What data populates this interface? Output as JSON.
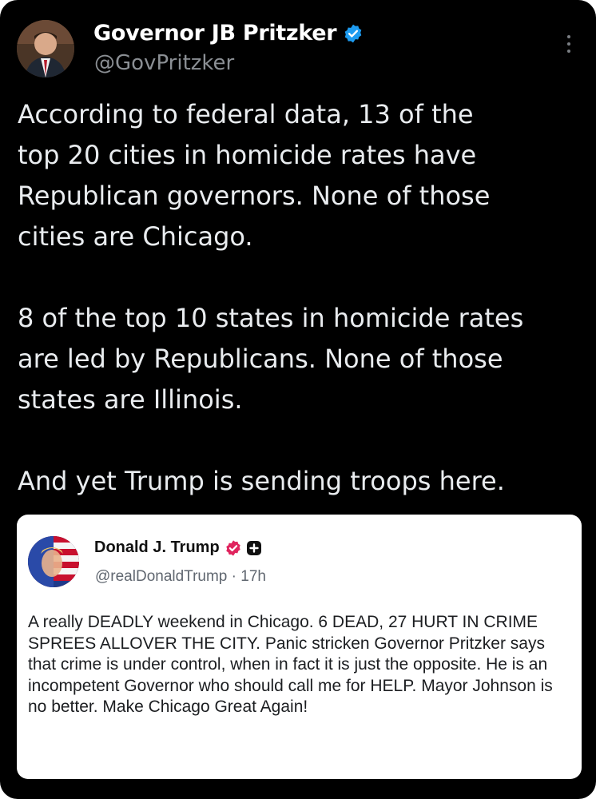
{
  "post": {
    "author_name": "Governor JB Pritzker",
    "author_handle": "@GovPritzker",
    "verified_icon": "verified-badge-icon",
    "more_icon": "more-options-icon",
    "text": "According to federal data, 13 of the\ntop 20 cities in homicide rates have\nRepublican governors. None of those\ncities are Chicago.\n\n8 of the top 10 states in homicide rates\nare led by Republicans. None of those\nstates are Illinois.\n\nAnd yet Trump is sending troops here."
  },
  "quoted_post": {
    "author_name": "Donald J. Trump",
    "author_handle": "@realDonaldTrump",
    "separator": " · ",
    "time_ago": "17h",
    "badge_icon": "verified-badge-icon",
    "plus_icon": "plus-icon",
    "text": "A really DEADLY weekend in Chicago. 6 DEAD, 27 HURT IN CRIME SPREES ALLOVER THE CITY. Panic stricken Governor Pritzker says that crime is under control, when in fact it is just the opposite. He is an incompetent Governor who should call me for HELP. Mayor Johnson is no better. Make Chicago Great Again!"
  },
  "colors": {
    "background": "#000000",
    "verified_blue": "#1d9bf0",
    "quote_badge": "#e0245e"
  }
}
